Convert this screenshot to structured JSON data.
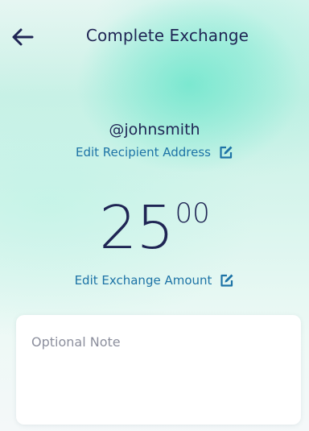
{
  "header": {
    "title": "Complete Exchange",
    "back_icon": "arrow-left-icon"
  },
  "recipient": {
    "handle": "@johnsmith",
    "edit_label": "Edit Recipient Address",
    "edit_icon": "edit-icon"
  },
  "amount": {
    "major": "25",
    "minor": "00",
    "edit_label": "Edit Exchange Amount",
    "edit_icon": "edit-icon"
  },
  "note": {
    "placeholder": "Optional Note",
    "value": ""
  },
  "colors": {
    "text_primary": "#1f2554",
    "link": "#1d73a6",
    "accent_mint": "#60e4c8",
    "card_bg": "#ffffff"
  }
}
